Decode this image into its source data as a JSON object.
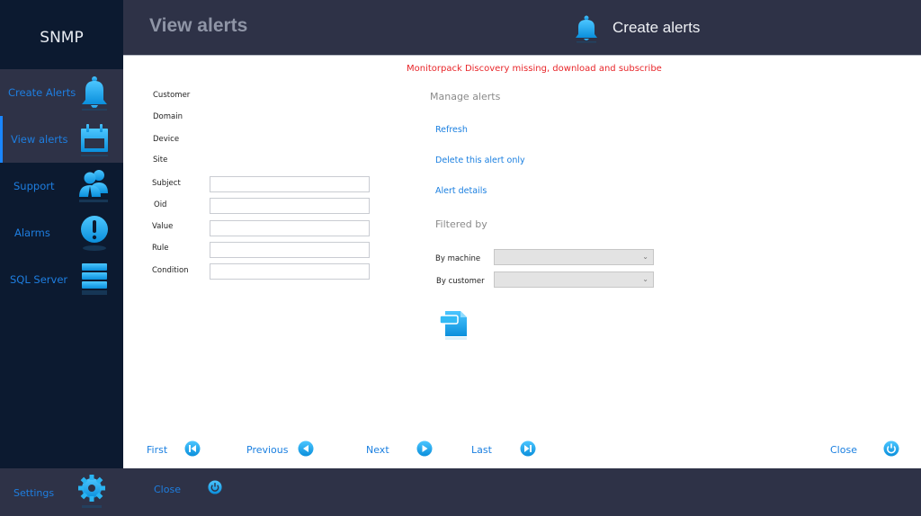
{
  "app": {
    "title": "SNMP"
  },
  "sidebar": {
    "items": [
      {
        "label": "Create Alerts",
        "icon": "bell-icon",
        "active": false
      },
      {
        "label": "View alerts",
        "icon": "calendar-icon",
        "active": true
      },
      {
        "label": "Support",
        "icon": "users-icon",
        "active": false
      },
      {
        "label": "Alarms",
        "icon": "exclamation-icon",
        "active": false
      },
      {
        "label": "SQL Server",
        "icon": "database-icon",
        "active": false
      }
    ],
    "settings_label": "Settings"
  },
  "header": {
    "title": "View alerts",
    "create_label": "Create alerts"
  },
  "content": {
    "warning": "Monitorpack Discovery missing, download and subscribe",
    "info_fields": [
      "Customer",
      "Domain",
      "Device",
      "Site"
    ],
    "input_fields": [
      {
        "label": "Subject",
        "value": ""
      },
      {
        "label": "Oid",
        "value": ""
      },
      {
        "label": "Value",
        "value": ""
      },
      {
        "label": "Rule",
        "value": ""
      },
      {
        "label": "Condition",
        "value": ""
      }
    ],
    "manage": {
      "title": "Manage alerts",
      "links": [
        "Refresh",
        "Delete this alert only",
        "Alert details"
      ]
    },
    "filter": {
      "title": "Filtered by",
      "by_machine_label": "By machine",
      "by_machine_value": "",
      "by_customer_label": "By customer",
      "by_customer_value": ""
    },
    "pager": {
      "first": "First",
      "previous": "Previous",
      "next": "Next",
      "last": "Last",
      "close": "Close"
    }
  },
  "footer": {
    "close_label": "Close"
  },
  "colors": {
    "accent": "#1a7fe0",
    "icon": "#19a9ec",
    "warning": "#e8262a",
    "sidebar": "#0c1a30",
    "chrome": "#2e3247"
  }
}
